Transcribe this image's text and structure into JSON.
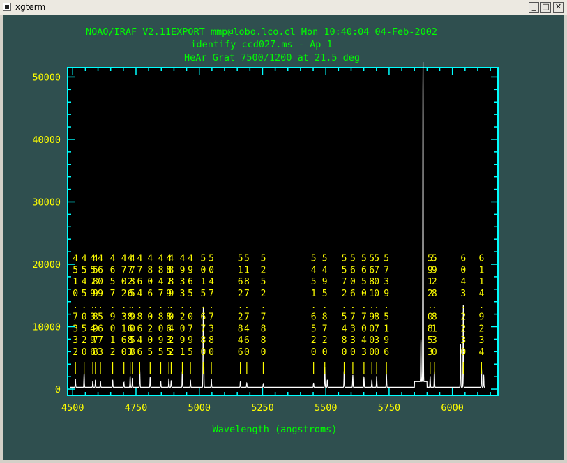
{
  "window": {
    "title": "xgterm",
    "buttons": {
      "minimize": "_",
      "maximize": "□",
      "close": "✕"
    }
  },
  "colors": {
    "background": "#2f4f4f",
    "plot_area": "#000000",
    "axis": "#00ffff",
    "header_text": "#00ff00",
    "tick_labels": "#ffff00",
    "line_ids": "#ffff00",
    "spectrum": "#ffffff"
  },
  "chart_data": {
    "type": "line",
    "title_lines": [
      "NOAO/IRAF V2.11EXPORT mmp@lobo.lco.cl Mon 10:40:04 04-Feb-2002",
      "identify ccd027.ms - Ap 1",
      "HeAr Grat 7500/1200 at 21.5 deg"
    ],
    "xlabel": "Wavelength (angstroms)",
    "ylabel": "",
    "xlim": [
      4480,
      6180
    ],
    "ylim": [
      -1000,
      51500
    ],
    "xticks": [
      4500,
      4750,
      5000,
      5250,
      5500,
      5750,
      6000
    ],
    "yticks": [
      0,
      10000,
      20000,
      30000,
      40000,
      50000
    ],
    "grid": false,
    "baseline": 300,
    "spectrum_lines": [
      {
        "x": 4510.7,
        "y": 1300
      },
      {
        "x": 4545.1,
        "y": 2200
      },
      {
        "x": 4579.4,
        "y": 1000
      },
      {
        "x": 4589.9,
        "y": 1200
      },
      {
        "x": 4609.6,
        "y": 1000
      },
      {
        "x": 4657.9,
        "y": 1200
      },
      {
        "x": 4702.3,
        "y": 800
      },
      {
        "x": 4726.9,
        "y": 1800
      },
      {
        "x": 4735.9,
        "y": 1500
      },
      {
        "x": 4764.9,
        "y": 2800
      },
      {
        "x": 4806.0,
        "y": 1600
      },
      {
        "x": 4847.8,
        "y": 900
      },
      {
        "x": 4879.9,
        "y": 1400
      },
      {
        "x": 4889.0,
        "y": 1100
      },
      {
        "x": 4933.2,
        "y": 2600
      },
      {
        "x": 4965.1,
        "y": 1200
      },
      {
        "x": 5015.7,
        "y": 10500
      },
      {
        "x": 5017.3,
        "y": 8000
      },
      {
        "x": 5047.7,
        "y": 1300
      },
      {
        "x": 5162.3,
        "y": 900
      },
      {
        "x": 5187.7,
        "y": 700
      },
      {
        "x": 5252.8,
        "y": 600
      },
      {
        "x": 5451.6,
        "y": 700
      },
      {
        "x": 5495.9,
        "y": 3200
      },
      {
        "x": 5506.1,
        "y": 1200
      },
      {
        "x": 5572.5,
        "y": 2600
      },
      {
        "x": 5606.7,
        "y": 2000
      },
      {
        "x": 5650.7,
        "y": 1600
      },
      {
        "x": 5681.9,
        "y": 1200
      },
      {
        "x": 5700.9,
        "y": 1800
      },
      {
        "x": 5739.5,
        "y": 2100
      },
      {
        "x": 5875.6,
        "y": 6800
      },
      {
        "x": 5883.9,
        "y": 51500
      },
      {
        "x": 5912.1,
        "y": 1800
      },
      {
        "x": 5928.8,
        "y": 2600
      },
      {
        "x": 6032.1,
        "y": 7000
      },
      {
        "x": 6043.2,
        "y": 13500
      },
      {
        "x": 6114.9,
        "y": 3100
      },
      {
        "x": 6123.4,
        "y": 2000
      }
    ],
    "line_ids": [
      {
        "x": 4510.7,
        "label": "4510.7332"
      },
      {
        "x": 4545.1,
        "label": "4545.0520"
      },
      {
        "x": 4579.4,
        "label": "4579.3496"
      },
      {
        "x": 4589.9,
        "label": "4589.8978"
      },
      {
        "x": 4609.6,
        "label": "4609.5673"
      },
      {
        "x": 4657.9,
        "label": "4657.9012"
      },
      {
        "x": 4702.3,
        "label": "4702.3160"
      },
      {
        "x": 4726.9,
        "label": "4726.8683"
      },
      {
        "x": 4735.9,
        "label": "4735.9058"
      },
      {
        "x": 4764.9,
        "label": "4764.8646"
      },
      {
        "x": 4806.0,
        "label": "4806.0205"
      },
      {
        "x": 4847.8,
        "label": "4847.8095"
      },
      {
        "x": 4879.9,
        "label": "4879.8635"
      },
      {
        "x": 4889.0,
        "label": "4889.0422"
      },
      {
        "x": 4933.2,
        "label": "4933.2091"
      },
      {
        "x": 4965.1,
        "label": "4965.0795"
      },
      {
        "x": 5015.7,
        "label": "5015.6780"
      },
      {
        "x": 5047.7,
        "label": "5047.7380"
      },
      {
        "x": 5162.3,
        "label": "5162.2846"
      },
      {
        "x": 5187.7,
        "label": "5187.7460"
      },
      {
        "x": 5252.8,
        "label": "5252.7880"
      },
      {
        "x": 5451.6,
        "label": "5451.6520"
      },
      {
        "x": 5495.9,
        "label": "5495.8720"
      },
      {
        "x": 5572.5,
        "label": "5572.5480"
      },
      {
        "x": 5606.7,
        "label": "5606.7330"
      },
      {
        "x": 5650.7,
        "label": "5650.7043"
      },
      {
        "x": 5681.9,
        "label": "5681.9000"
      },
      {
        "x": 5700.9,
        "label": "5700.8730"
      },
      {
        "x": 5739.5,
        "label": "5739.5196"
      },
      {
        "x": 5912.1,
        "label": "5912.0853"
      },
      {
        "x": 5928.8,
        "label": "5928.8130"
      },
      {
        "x": 6043.2,
        "label": "6043.2230"
      },
      {
        "x": 6114.9,
        "label": "6114.9234"
      }
    ]
  }
}
